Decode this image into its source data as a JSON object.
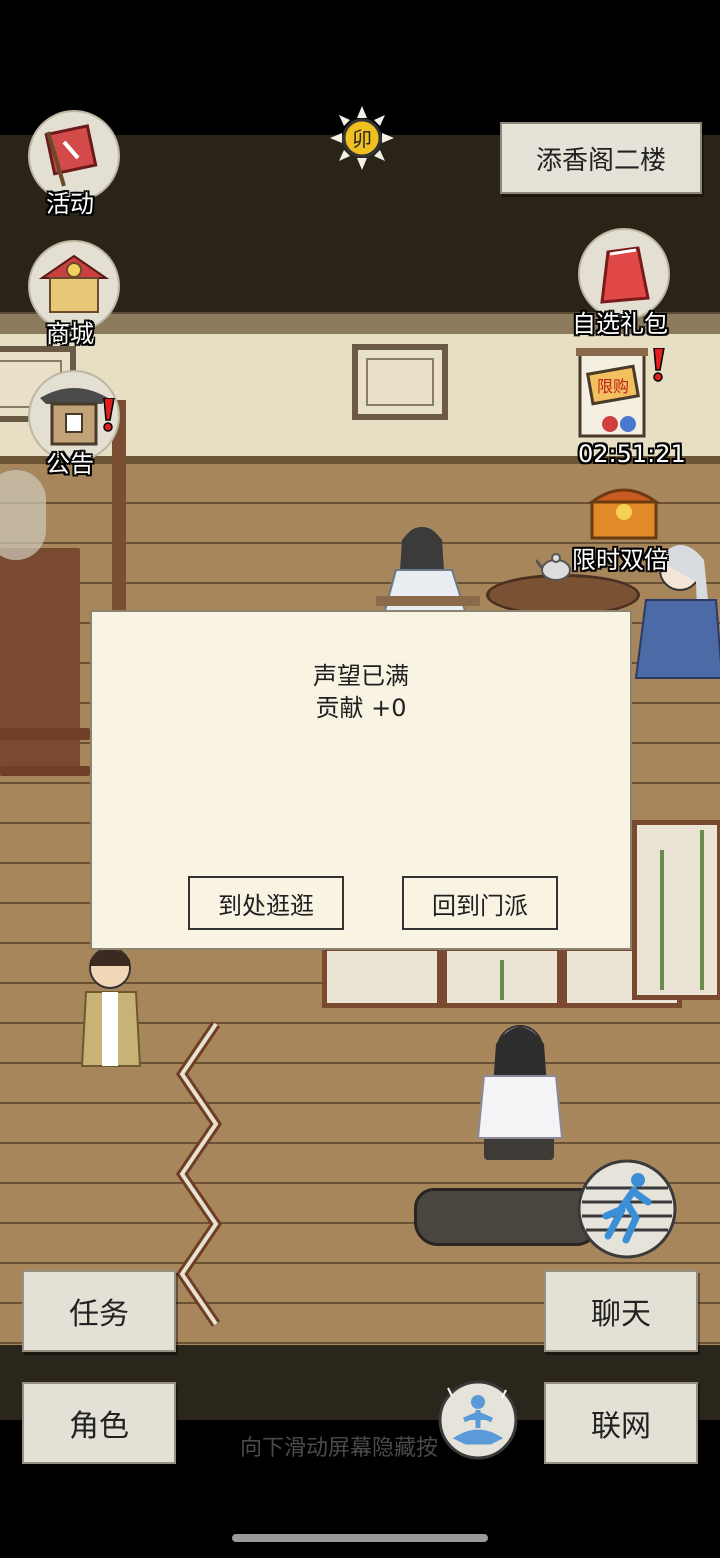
{
  "location": {
    "name": "添香阁二楼"
  },
  "time_badge": {
    "label": "卯"
  },
  "left_menu": [
    {
      "label": "活动",
      "icon": "banner-flag-icon"
    },
    {
      "label": "商城",
      "icon": "shop-stall-icon"
    },
    {
      "label": "公告",
      "icon": "notice-gate-icon",
      "alert": true
    }
  ],
  "right_menu": {
    "gift": {
      "label": "自选礼包",
      "icon": "gift-bag-icon"
    },
    "sale": {
      "label": "限购",
      "timer": "02:51:21",
      "icon": "sale-scroll-icon",
      "alert": true
    },
    "double": {
      "label": "限时双倍",
      "icon": "treasure-chest-icon"
    }
  },
  "dialog": {
    "line1": "声望已满",
    "line2": "贡献 +0",
    "buttons": [
      "到处逛逛",
      "回到门派"
    ]
  },
  "bottom_buttons": {
    "task": "任务",
    "chat": "聊天",
    "role": "角色",
    "network": "联网"
  },
  "hint": "向下滑动屏幕隐藏按",
  "colors": {
    "panel": "#f8f3e3",
    "button": "#e3e0d6",
    "floor": "#a8865c",
    "run_icon": "#3b8fd6"
  }
}
